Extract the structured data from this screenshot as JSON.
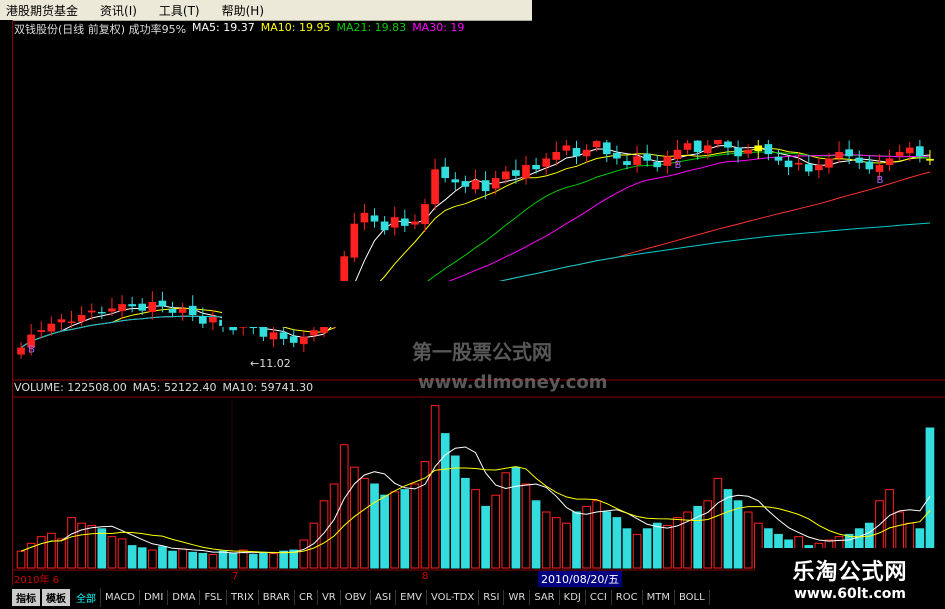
{
  "menu": {
    "items": [
      "港股期货基金",
      "资讯(I)",
      "工具(T)",
      "帮助(H)"
    ]
  },
  "info": {
    "title": "双钱股份(日线 前复权) 成功率95%",
    "ma5": "MA5: 19.37",
    "ma10": "MA10: 19.95",
    "ma21": "MA21: 19.83",
    "ma30": "MA30: 19",
    "colors": {
      "title": "#dddddd",
      "ma5": "#ffffff",
      "ma10": "#ffff00",
      "ma21": "#00cc00",
      "ma30": "#ff00ff"
    }
  },
  "annotations": {
    "buy_marker": "B",
    "low_price": "←11.02"
  },
  "volume_info": {
    "volume": "VOLUME: 122508.00",
    "ma5": "MA5: 52122.40",
    "ma10": "MA10: 59741.30"
  },
  "watermark": {
    "text1": "第一股票公式网",
    "text2": "www.dlmoney.com"
  },
  "dates": {
    "start": "2010年 6",
    "m7": "7",
    "m8": "8",
    "cursor": "2010/08/20/五"
  },
  "tabs": {
    "buttons": [
      "指标",
      "模板"
    ],
    "active": "全部",
    "items": [
      "MACD",
      "DMI",
      "DMA",
      "FSL",
      "TRIX",
      "BRAR",
      "CR",
      "VR",
      "OBV",
      "ASI",
      "EMV",
      "VOL-TDX",
      "RSI",
      "WR",
      "SAR",
      "KDJ",
      "CCI",
      "ROC",
      "MTM",
      "BOLL"
    ]
  },
  "logo": {
    "name": "乐淘公式网",
    "url": "www.60lt.com"
  },
  "chart_data": {
    "type": "candlestick",
    "approx_closes": [
      10.8,
      11.4,
      11.6,
      11.9,
      12.1,
      12.0,
      12.3,
      12.5,
      12.4,
      12.6,
      12.8,
      12.7,
      12.5,
      12.9,
      12.7,
      12.4,
      12.6,
      12.3,
      11.9,
      12.2,
      11.8,
      11.6,
      12.0,
      11.7,
      11.3,
      11.5,
      11.2,
      11.02,
      11.3,
      11.6,
      12.0,
      13.5,
      15.0,
      16.5,
      17.0,
      16.6,
      16.2,
      16.8,
      16.4,
      16.6,
      17.4,
      19.0,
      18.6,
      18.4,
      18.2,
      18.5,
      18.0,
      18.6,
      18.9,
      18.7,
      19.2,
      19.0,
      19.5,
      19.8,
      20.1,
      19.6,
      19.9,
      20.3,
      19.7,
      19.5,
      19.2,
      19.6,
      19.4,
      19.1,
      19.6,
      19.9,
      20.2,
      19.8,
      20.1,
      20.4,
      20.0,
      19.6,
      19.9,
      20.1,
      19.7,
      19.4,
      19.1,
      19.3,
      18.9,
      19.2,
      19.5,
      19.8,
      19.6,
      19.3,
      19.0,
      19.2,
      19.5,
      19.8,
      20.0,
      19.6,
      19.4
    ],
    "volumes": [
      1.5,
      2.2,
      2.8,
      3.1,
      2.6,
      4.5,
      4.0,
      3.8,
      3.5,
      2.8,
      2.6,
      2.0,
      1.8,
      1.6,
      1.9,
      1.5,
      1.7,
      1.4,
      1.3,
      1.2,
      1.5,
      1.3,
      1.6,
      1.2,
      1.4,
      1.3,
      1.5,
      1.6,
      2.5,
      4.0,
      6.0,
      7.5,
      11.0,
      9.0,
      8.0,
      7.5,
      6.5,
      6.8,
      7.0,
      7.5,
      9.5,
      14.5,
      12.0,
      10.0,
      8.0,
      7.0,
      5.5,
      6.5,
      8.5,
      9.0,
      7.5,
      6.0,
      5.0,
      4.5,
      4.0,
      5.0,
      5.5,
      6.0,
      5.0,
      4.5,
      3.5,
      3.0,
      3.5,
      4.0,
      3.8,
      4.5,
      5.0,
      5.5,
      6.0,
      8.0,
      7.0,
      6.0,
      5.0,
      4.0,
      3.5,
      3.0,
      2.5,
      2.8,
      2.0,
      2.2,
      2.5,
      2.8,
      3.0,
      3.5,
      4.0,
      6.0,
      7.0,
      5.0,
      4.0,
      3.5,
      12.5
    ],
    "ma_colors": {
      "ma5": "#ffffff",
      "ma10": "#ffff00",
      "ma21": "#00cc00",
      "ma30": "#ff00ff",
      "ma60": "#ff3333",
      "ma120": "#00cccc"
    },
    "up_color": "#ff2020",
    "down_color": "#33dddd",
    "signal_color": "#ffff00"
  }
}
